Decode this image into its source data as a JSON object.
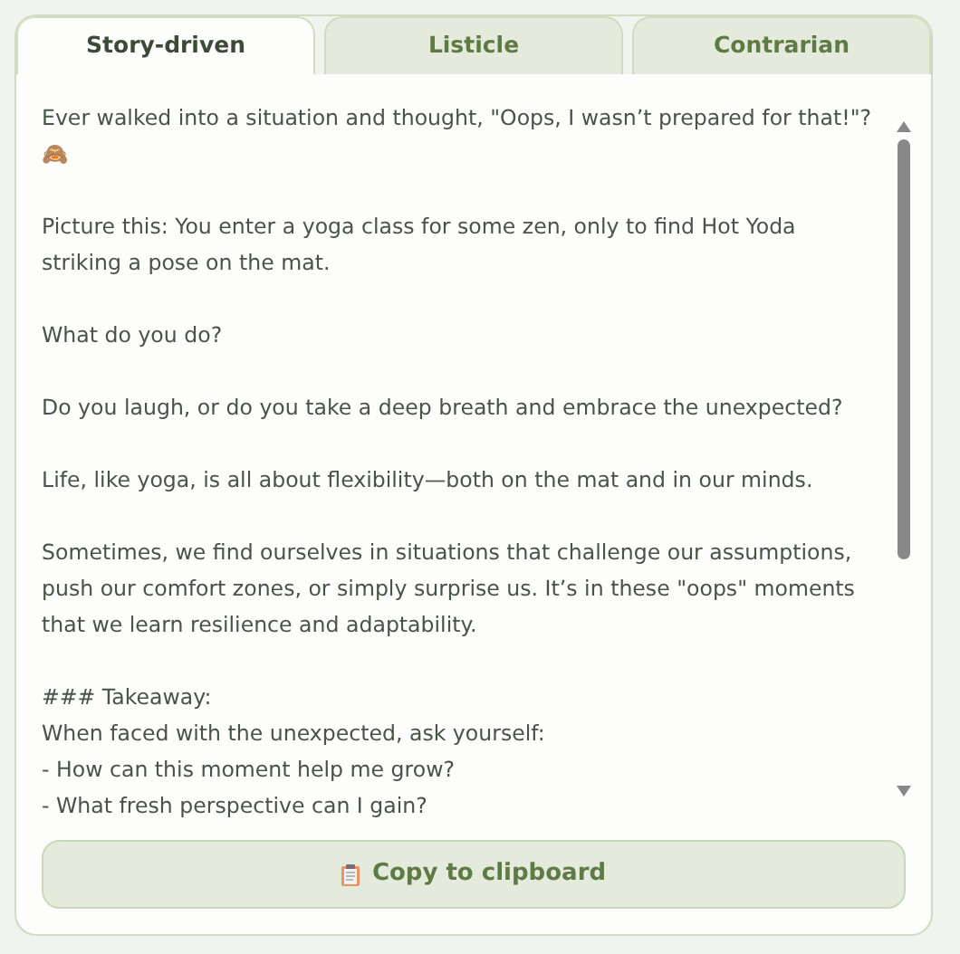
{
  "tabs": [
    {
      "label": "Story-driven",
      "selected": true
    },
    {
      "label": "Listicle",
      "selected": false
    },
    {
      "label": "Contrarian",
      "selected": false
    }
  ],
  "paragraphs": [
    [
      "Ever walked into a situation and thought, \"Oops, I wasn’t prepared for that!\"?",
      "🙈"
    ],
    [
      "Picture this: You enter a yoga class for some zen, only to find Hot Yoda",
      "striking a pose on the mat."
    ],
    [
      "What do you do?"
    ],
    [
      "Do you laugh, or do you take a deep breath and embrace the unexpected?"
    ],
    [
      "Life, like yoga, is all about flexibility—both on the mat and in our minds."
    ],
    [
      "Sometimes, we find ourselves in situations that challenge our assumptions,",
      "push our comfort zones, or simply surprise us. It’s in these \"oops\" moments",
      "that we learn resilience and adaptability."
    ],
    [
      "### Takeaway:",
      "When faced with the unexpected, ask yourself:",
      "- How can this moment help me grow?",
      "- What fresh perspective can I gain?"
    ]
  ],
  "copy_button": {
    "label": "Copy to clipboard"
  }
}
